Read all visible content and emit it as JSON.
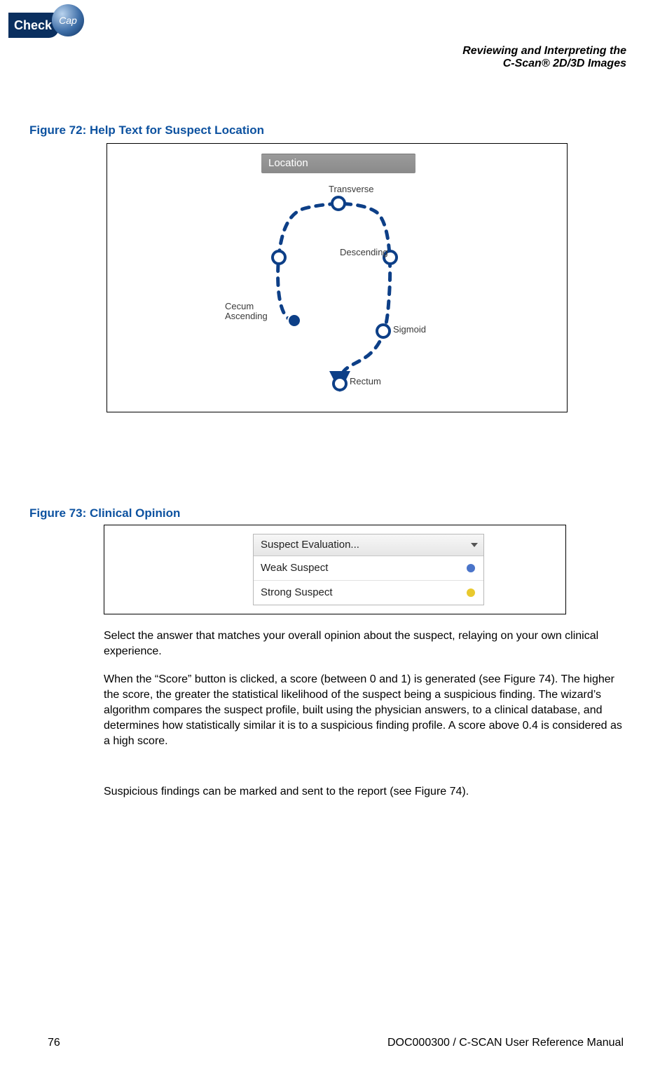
{
  "logo": {
    "word1": "Check",
    "word2": "Cap"
  },
  "running_head": {
    "line1": "Reviewing and Interpreting the",
    "line2": "C-Scan® 2D/3D Images"
  },
  "fig72": {
    "caption": "Figure 72: Help Text for Suspect Location",
    "panel_title": "Location",
    "labels": {
      "transverse": "Transverse",
      "descending": "Descending",
      "cecum": "Cecum",
      "ascending": "Ascending",
      "sigmoid": "Sigmoid",
      "rectum": "Rectum"
    }
  },
  "fig73": {
    "caption": "Figure 73: Clinical Opinion",
    "dropdown": {
      "placeholder": "Suspect Evaluation...",
      "options": [
        {
          "label": "Weak Suspect",
          "dot": "blue"
        },
        {
          "label": "Strong Suspect",
          "dot": "yellow"
        }
      ]
    }
  },
  "paragraphs": {
    "p1": "Select the answer that matches your overall opinion about the suspect, relaying on your own clinical experience.",
    "p2": "When the “Score” button is clicked, a score (between 0 and 1) is generated (see Figure 74). The higher the score, the greater the statistical likelihood of the suspect being a suspicious finding. The wizard’s algorithm compares the suspect profile, built using the physician answers, to a clinical database, and determines how statistically similar it is to a suspicious finding profile. A score above 0.4 is considered as a high score.",
    "p3": "Suspicious findings can be marked and sent to the report (see Figure 74)."
  },
  "footer": {
    "page_number": "76",
    "manual_id": "DOC000300 / C-SCAN User Reference Manual"
  }
}
